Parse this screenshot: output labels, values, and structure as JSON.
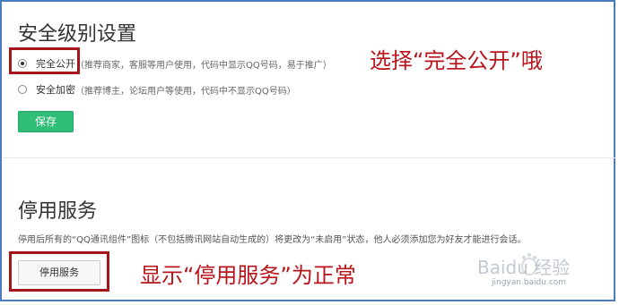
{
  "security": {
    "title": "安全级别设置",
    "options": [
      {
        "label": "完全公开",
        "description": "（推荐商家，客服等用户使用，代码中显示QQ号码，易于推广）",
        "checked": true
      },
      {
        "label": "安全加密",
        "description": "（推荐博主，论坛用户等使用，代码中不显示QQ号码）",
        "checked": false
      }
    ],
    "save_label": "保存",
    "save_color": "#2fbe77"
  },
  "stop_service": {
    "title": "停用服务",
    "description": "停用后所有的“QQ通讯组件”图标（不包括腾讯网站自动生成的）将更改为“未启用”状态，他人必须添加您为好友才能进行会话。",
    "button_label": "停用服务"
  },
  "annotations": {
    "top": "选择“完全公开”哦",
    "bottom": "显示“停用服务”为正常",
    "color": "#b8141c"
  },
  "watermark": {
    "brand": "Baidu 经验",
    "url": "jingyan.baidu.com"
  }
}
